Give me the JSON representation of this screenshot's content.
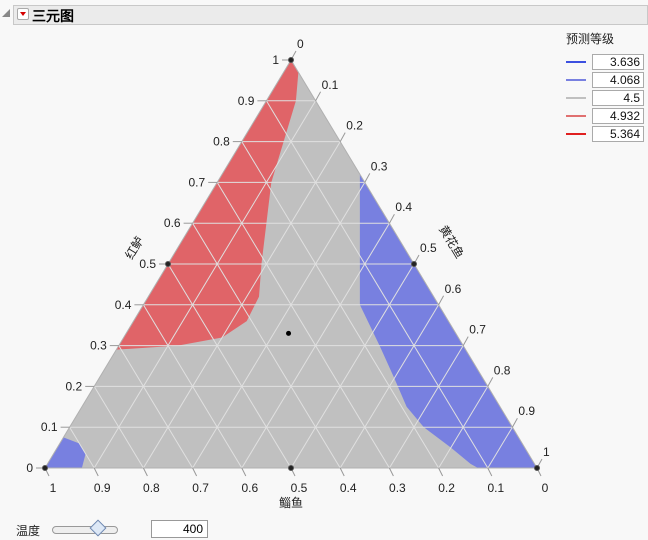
{
  "header": {
    "title": "三元图"
  },
  "legend": {
    "title": "预测等级",
    "items": [
      {
        "value": "3.636",
        "color": "#3c50e0"
      },
      {
        "value": "4.068",
        "color": "#7880e0"
      },
      {
        "value": "4.5",
        "color": "#c0c0c0"
      },
      {
        "value": "4.932",
        "color": "#e07070"
      },
      {
        "value": "5.364",
        "color": "#e02020"
      }
    ]
  },
  "slider": {
    "label": "温度",
    "value": "400",
    "fraction": 0.5
  },
  "chart_data": {
    "type": "ternary",
    "axes": {
      "left": {
        "label": "红鲈",
        "ticks": [
          "0",
          "0.1",
          "0.2",
          "0.3",
          "0.4",
          "0.5",
          "0.6",
          "0.7",
          "0.8",
          "0.9",
          "1"
        ]
      },
      "right": {
        "label": "黄花鱼",
        "ticks": [
          "0",
          "0.1",
          "0.2",
          "0.3",
          "0.4",
          "0.5",
          "0.6",
          "0.7",
          "0.8",
          "0.9",
          "1"
        ]
      },
      "bottom": {
        "label": "鲻鱼",
        "ticks": [
          "1",
          "0.9",
          "0.8",
          "0.7",
          "0.6",
          "0.5",
          "0.4",
          "0.3",
          "0.2",
          "0.1",
          "0"
        ]
      }
    },
    "fill_colors": {
      "background": "#c0c0c0",
      "high": "#e06468",
      "low": "#7880e0"
    },
    "regions": [
      {
        "name": "high-region",
        "level": "4.932",
        "color": "#e06468",
        "points": [
          [
            1,
            0
          ],
          [
            0.9,
            0.03
          ],
          [
            0.8,
            0.06
          ],
          [
            0.7,
            0.1
          ],
          [
            0.6,
            0.16
          ],
          [
            0.5,
            0.22
          ],
          [
            0.4,
            0.27
          ],
          [
            0.33,
            0.29
          ],
          [
            0.3,
            0.3
          ],
          [
            0.28,
            0.3
          ],
          [
            0.28,
            0.0
          ]
        ]
      },
      {
        "name": "low-region-right",
        "level": "4.068",
        "color": "#7880e0",
        "points": [
          [
            0,
            0.63
          ],
          [
            0.05,
            0.59
          ],
          [
            0.1,
            0.55
          ],
          [
            0.15,
            0.5
          ],
          [
            0.2,
            0.45
          ],
          [
            0.25,
            0.4
          ],
          [
            0.28,
            0.36
          ],
          [
            0.3,
            0.33
          ],
          [
            0.32,
            0.3
          ],
          [
            0.34,
            0.29
          ],
          [
            0.28,
            0.0
          ]
        ]
      },
      {
        "name": "low-region-corner",
        "level": "4.068",
        "color": "#7880e0",
        "points": [
          [
            0,
            0
          ],
          [
            0.07,
            0
          ],
          [
            0,
            0.07
          ]
        ]
      }
    ],
    "points": [
      {
        "a": 1,
        "b": 0
      },
      {
        "a": 0.5,
        "b": 0
      },
      {
        "a": 0,
        "b": 0
      },
      {
        "a": 0.5,
        "b": 0.5
      },
      {
        "a": 0,
        "b": 1
      },
      {
        "a": 0,
        "b": 0.5
      },
      {
        "a": 0.33,
        "b": 0.33
      }
    ]
  }
}
